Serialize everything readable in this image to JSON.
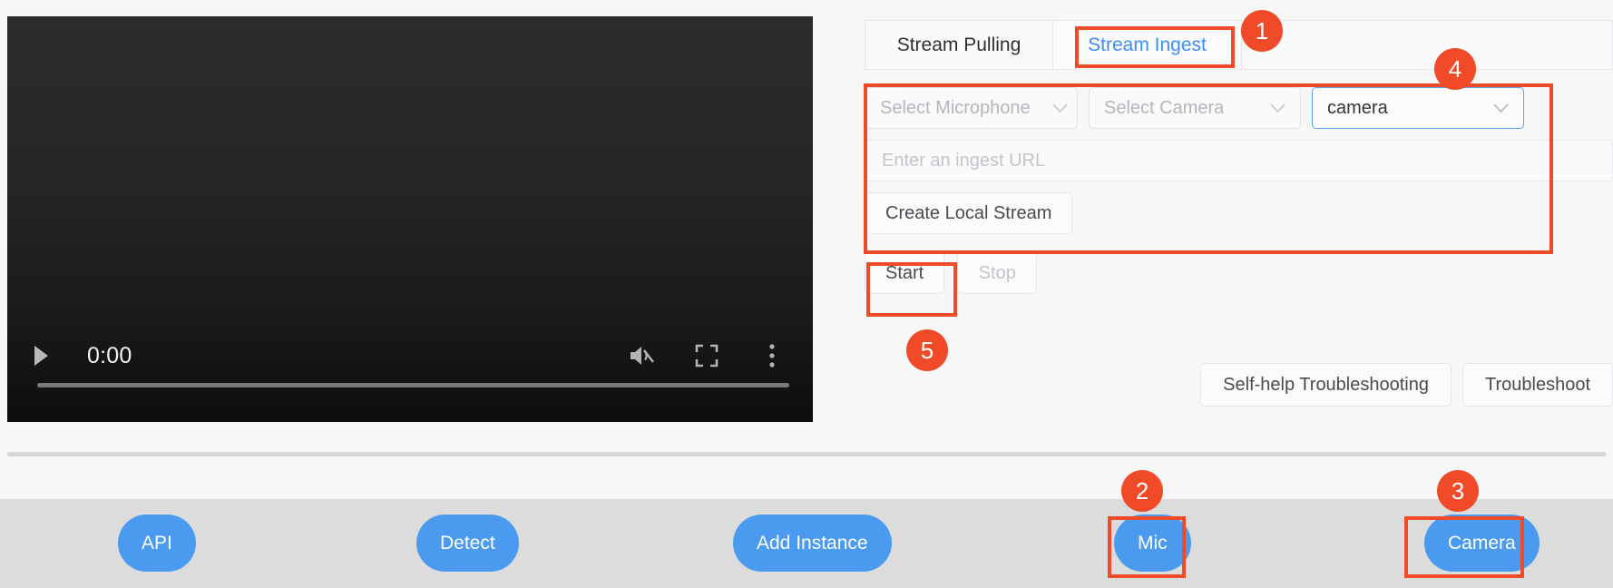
{
  "video": {
    "time": "0:00",
    "play_icon": "play-icon",
    "mute_icon": "volume-muted-icon",
    "fullscreen_icon": "fullscreen-icon",
    "more_icon": "more-vertical-icon",
    "progress_percent": 0
  },
  "tabs": [
    {
      "label": "Stream Pulling",
      "active": false
    },
    {
      "label": "Stream Ingest",
      "active": true
    }
  ],
  "form": {
    "microphone_select": "Select Microphone",
    "camera_select": "Select Camera",
    "camera_named_select": "camera",
    "url_placeholder": "Enter an ingest URL",
    "url_value": "",
    "create_local_stream": "Create Local Stream",
    "start_label": "Start",
    "stop_label": "Stop",
    "chevron_icon": "chevron-down-icon"
  },
  "troubleshoot": {
    "self_help": "Self-help Troubleshooting",
    "troubleshoot": "Troubleshoot"
  },
  "dock": {
    "buttons": [
      {
        "label": "API"
      },
      {
        "label": "Detect"
      },
      {
        "label": "Add Instance"
      },
      {
        "label": "Mic"
      },
      {
        "label": "Camera"
      }
    ]
  },
  "annotations": {
    "badges": [
      "1",
      "2",
      "3",
      "4",
      "5"
    ]
  },
  "colors": {
    "accent_blue": "#3d8ef7",
    "pill_blue": "#4a9bf0",
    "annotation_orange": "#f04a28",
    "dock_gray": "#dcdcdc",
    "page_bg": "#f7f7f8"
  }
}
